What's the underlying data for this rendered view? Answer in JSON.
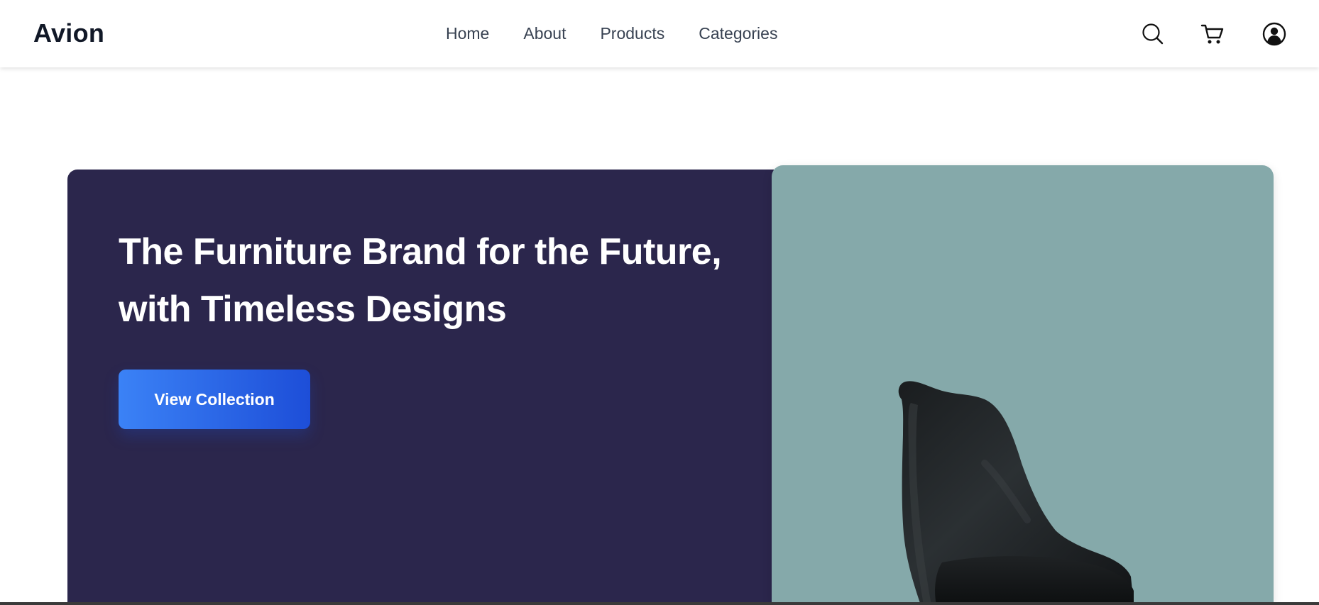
{
  "brand": {
    "name": "Avion"
  },
  "nav": {
    "links": [
      {
        "label": "Home"
      },
      {
        "label": "About"
      },
      {
        "label": "Products"
      },
      {
        "label": "Categories"
      }
    ],
    "icons": [
      "search-icon",
      "cart-icon",
      "user-icon"
    ]
  },
  "hero": {
    "title_line1": "The Furniture Brand for the Future,",
    "title_line2": "with Timeless Designs",
    "cta_label": "View Collection",
    "image": "black-chair"
  },
  "colors": {
    "hero_panel": "#2b264c",
    "image_panel": "#85a9aa",
    "cta_gradient_start": "#3b82f6",
    "cta_gradient_end": "#1d4ed8",
    "text_dark": "#111827"
  }
}
